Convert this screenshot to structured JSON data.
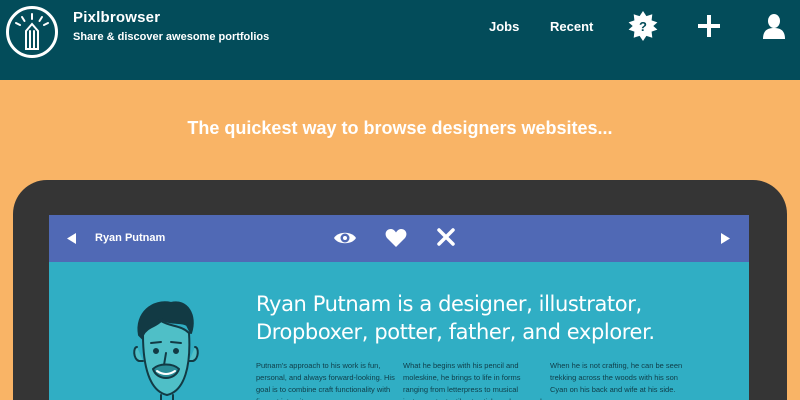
{
  "header": {
    "brand_name": "Pixlbrowser",
    "brand_tagline": "Share & discover awesome portfolios",
    "nav": {
      "jobs": "Jobs",
      "recent": "Recent"
    },
    "help_badge": "?"
  },
  "hero": {
    "headline": "The quickest way to browse designers websites..."
  },
  "viewer": {
    "designer_name": "Ryan Putnam",
    "intro": "Ryan Putnam is a designer, illustrator, Dropboxer, potter, father, and explorer.",
    "columns": [
      "Putnam's approach to his work is fun, personal, and always forward-looking. His goal is to combine craft functionality with fine art integrity.",
      "What he begins with his pencil and moleskine, he brings to life in forms ranging from letterpress to musical instruments, textiles to stickers, logos and more.",
      "When he is not crafting, he can be seen trekking across the woods with his son Cyan on his back and wife at his side."
    ]
  },
  "colors": {
    "header_bg": "#034c5a",
    "page_bg": "#f9b466",
    "device_bg": "#353535",
    "viewer_bar": "#5069b5",
    "screen_bg": "#30aec4"
  },
  "icons": [
    "pencil-logo-icon",
    "help-badge-icon",
    "plus-icon",
    "user-icon",
    "chevron-left-icon",
    "eye-icon",
    "heart-icon",
    "close-icon",
    "chevron-right-icon"
  ]
}
